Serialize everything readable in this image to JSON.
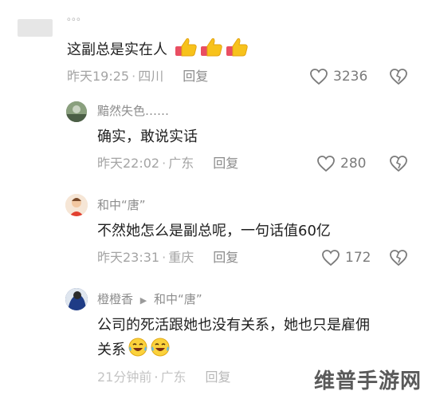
{
  "comments": [
    {
      "username": "。。。",
      "text": "这副总是实在人",
      "emojis": [
        "thumbs-up-icon",
        "thumbs-up-icon",
        "thumbs-up-icon"
      ],
      "time": "昨天19:25",
      "location": "四川",
      "reply_label": "回复",
      "likes": "3236"
    },
    {
      "username": "黯然失色……",
      "text": "确实，敢说实话",
      "time": "昨天22:02",
      "location": "广东",
      "reply_label": "回复",
      "likes": "280"
    },
    {
      "username": "和中“唐”",
      "text": "不然她怎么是副总呢，一句话值60亿",
      "time": "昨天23:31",
      "location": "重庆",
      "reply_label": "回复",
      "likes": "172"
    },
    {
      "username": "橙橙香",
      "reply_to": "和中“唐”",
      "text_line1": "公司的死活跟她也没有关系，她也只是雇佣",
      "text_line2": "关系",
      "emojis": [
        "laughing-tears-icon",
        "laughing-tears-icon"
      ],
      "time": "21分钟前",
      "location": "广东",
      "reply_label": "回复"
    }
  ],
  "watermark": "维普手游网",
  "colors": {
    "meta_text": "#a4a4a4",
    "username": "#8d8d8d",
    "body_text": "#1f1f1f",
    "thumbs_yellow": "#f7c21b",
    "sleeve_pink": "#e94e62"
  }
}
